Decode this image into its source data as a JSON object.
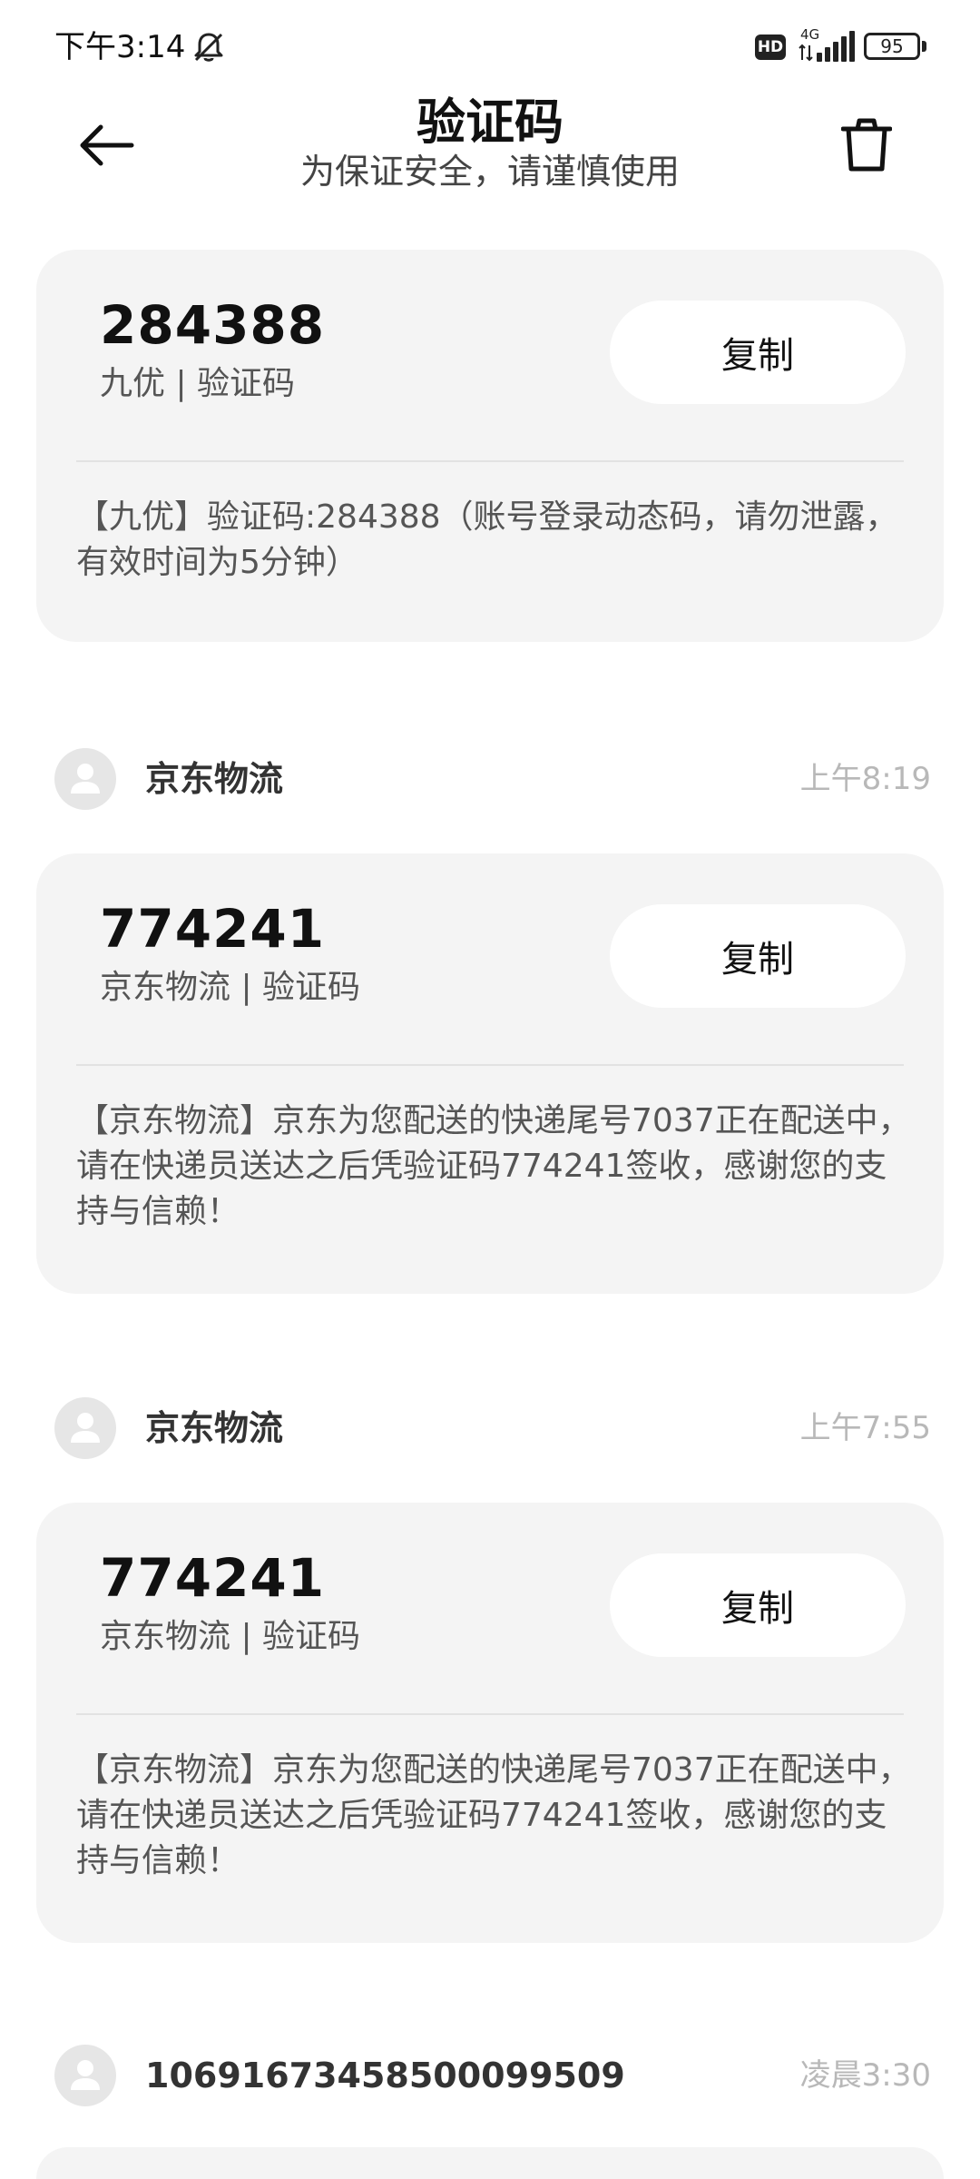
{
  "status_bar": {
    "time": "下午3:14",
    "hd_badge": "HD",
    "network": "4G",
    "battery": "95"
  },
  "header": {
    "title": "验证码",
    "subtitle": "为保证安全，请谨慎使用"
  },
  "messages": [
    {
      "sender": "",
      "time": "",
      "code": "284388",
      "meta": "九优 | 验证码",
      "copy_label": "复制",
      "body": "【九优】验证码:284388（账号登录动态码，请勿泄露，有效时间为5分钟）"
    },
    {
      "sender": "京东物流",
      "time": "上午8:19",
      "code": "774241",
      "meta": "京东物流 | 验证码",
      "copy_label": "复制",
      "body": "【京东物流】京东为您配送的快递尾号7037正在配送中，请在快递员送达之后凭验证码774241签收，感谢您的支持与信赖！"
    },
    {
      "sender": "京东物流",
      "time": "上午7:55",
      "code": "774241",
      "meta": "京东物流 | 验证码",
      "copy_label": "复制",
      "body": "【京东物流】京东为您配送的快递尾号7037正在配送中，请在快递员送达之后凭验证码774241签收，感谢您的支持与信赖！"
    },
    {
      "sender": "10691673458500099509",
      "time": "凌晨3:30"
    }
  ],
  "colors": {
    "card_background": "#f4f4f4",
    "button_background": "#ffffff",
    "timestamp": "#b8b8b8",
    "avatar": "#e6e6e6"
  },
  "icons": {
    "back": "back-arrow-icon",
    "trash": "trash-icon",
    "avatar": "person-icon",
    "bell": "bell-off-icon"
  }
}
